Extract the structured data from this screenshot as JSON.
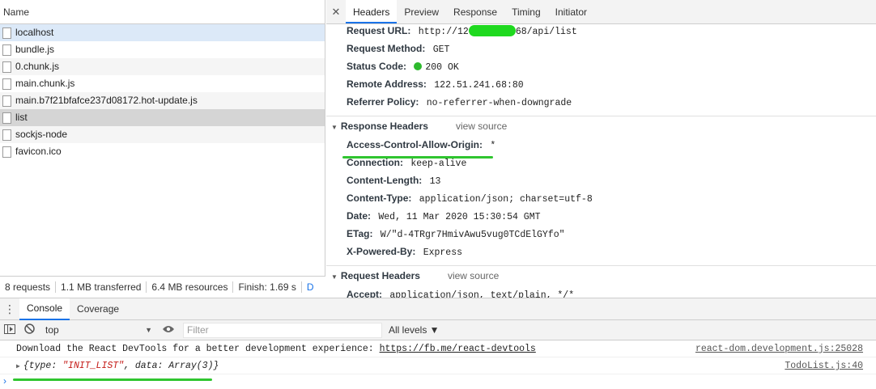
{
  "network": {
    "name_header": "Name",
    "requests": [
      {
        "name": "localhost"
      },
      {
        "name": "bundle.js"
      },
      {
        "name": "0.chunk.js"
      },
      {
        "name": "main.chunk.js"
      },
      {
        "name": "main.b7f21bfafce237d08172.hot-update.js"
      },
      {
        "name": "list"
      },
      {
        "name": "sockjs-node"
      },
      {
        "name": "favicon.ico"
      }
    ],
    "status": {
      "requests": "8 requests",
      "transferred": "1.1 MB transferred",
      "resources": "6.4 MB resources",
      "finish": "Finish: 1.69 s",
      "dom": "D"
    }
  },
  "details": {
    "close": "✕",
    "tabs": [
      "Headers",
      "Preview",
      "Response",
      "Timing",
      "Initiator"
    ],
    "general": {
      "url_key": "Request URL:",
      "url_prefix": "http://12",
      "url_suffix": "68/api/list",
      "method_key": "Request Method:",
      "method_val": "GET",
      "status_key": "Status Code:",
      "status_val": "200 OK",
      "remote_key": "Remote Address:",
      "remote_val": "122.51.241.68:80",
      "referrer_key": "Referrer Policy:",
      "referrer_val": "no-referrer-when-downgrade"
    },
    "response_headers": {
      "title": "Response Headers",
      "view_source": "view source",
      "rows": [
        {
          "key": "Access-Control-Allow-Origin:",
          "val": "*"
        },
        {
          "key": "Connection:",
          "val": "keep-alive"
        },
        {
          "key": "Content-Length:",
          "val": "13"
        },
        {
          "key": "Content-Type:",
          "val": "application/json; charset=utf-8"
        },
        {
          "key": "Date:",
          "val": "Wed, 11 Mar 2020 15:30:54 GMT"
        },
        {
          "key": "ETag:",
          "val": "W/\"d-4TRgr7HmivAwu5vug0TCdElGYfo\""
        },
        {
          "key": "X-Powered-By:",
          "val": "Express"
        }
      ]
    },
    "request_headers": {
      "title": "Request Headers",
      "view_source": "view source",
      "rows": [
        {
          "key": "Accept:",
          "val": "application/json, text/plain, */*"
        }
      ]
    }
  },
  "drawer": {
    "tabs": [
      "Console",
      "Coverage"
    ],
    "toolbar": {
      "context": "top",
      "filter_placeholder": "Filter",
      "levels": "All levels ▼"
    },
    "messages": {
      "m1_text": "Download the React DevTools for a better development experience: ",
      "m1_link": "https://fb.me/react-devtools",
      "m1_src": "react-dom.development.js:25028",
      "m2_prefix": "{type: ",
      "m2_type": "\"INIT_LIST\"",
      "m2_suffix": ", data: Array(3)}",
      "m2_src": "TodoList.js:40"
    },
    "prompt": "›"
  },
  "colors": {
    "accent": "#1a73e8",
    "annotation": "#2fc52f",
    "selected_row": "#dce9f8",
    "highlight_row": "#d5d5d5"
  }
}
